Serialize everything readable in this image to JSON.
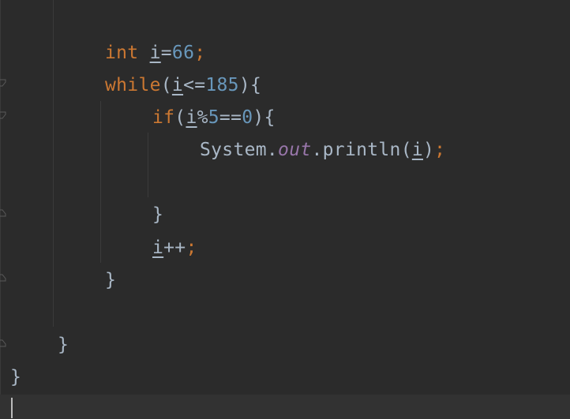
{
  "editor": {
    "language": "java",
    "lines": {
      "l1_kw": "int",
      "l1_var": "i",
      "l1_eq": "=",
      "l1_num": "66",
      "l1_semi": ";",
      "l2_kw": "while",
      "l2_open": "(",
      "l2_var": "i",
      "l2_op": "<=",
      "l2_num": "185",
      "l2_close": "){",
      "l3_kw": "if",
      "l3_open": "(",
      "l3_var": "i",
      "l3_mod": "%",
      "l3_num1": "5",
      "l3_eq": "==",
      "l3_num2": "0",
      "l3_close": "){",
      "l4_class": "System",
      "l4_dot1": ".",
      "l4_field": "out",
      "l4_dot2": ".",
      "l4_method": "println",
      "l4_open": "(",
      "l4_var": "i",
      "l4_close": ")",
      "l4_semi": ";",
      "l6_brace": "}",
      "l7_var": "i",
      "l7_inc": "++",
      "l7_semi": ";",
      "l8_brace": "}",
      "l10_brace": "}",
      "l11_brace": "}"
    },
    "colors": {
      "background": "#2b2b2b",
      "keyword": "#cc7832",
      "number": "#6897bb",
      "identifier": "#a9b7c6",
      "field": "#9876aa"
    }
  }
}
